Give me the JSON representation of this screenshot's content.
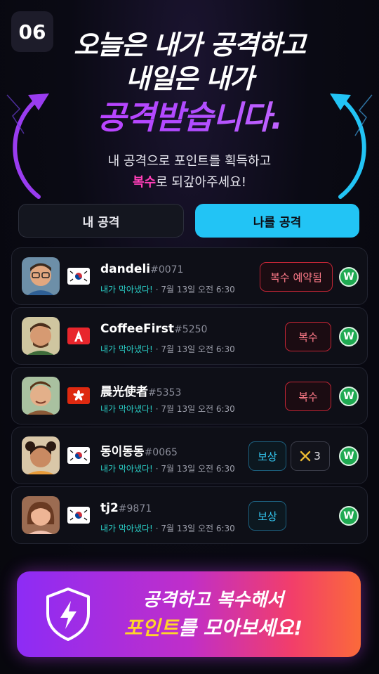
{
  "step_number": "06",
  "headline": {
    "line1": "오늘은 내가 공격하고",
    "line2": "내일은 내가",
    "line3": "공격받습니다."
  },
  "subtitle": {
    "line1": "내 공격으로 포인트를 획득하고",
    "line2_highlight": "복수",
    "line2_rest": "로 되갚아주세요!"
  },
  "tabs": [
    {
      "label": "내 공격",
      "active": false
    },
    {
      "label": "나를 공격",
      "active": true
    }
  ],
  "rows": [
    {
      "name": "dandeli",
      "tag": "#0071",
      "flag": "south-korea",
      "status": "내가 막아냈다!",
      "time": "· 7월 13일 오전 6:30",
      "revenge_label": "복수 예약됨",
      "reward_label": "",
      "count": "",
      "result": "W"
    },
    {
      "name": "CoffeeFirst",
      "tag": "#5250",
      "flag": "red-a-flag",
      "status": "내가 막아냈다!",
      "time": "· 7월 13일 오전 6:30",
      "revenge_label": "복수",
      "reward_label": "",
      "count": "",
      "result": "W"
    },
    {
      "name": "晨光使者",
      "tag": "#5353",
      "flag": "hong-kong",
      "status": "내가 막아냈다!",
      "time": "· 7월 13일 오전 6:30",
      "revenge_label": "복수",
      "reward_label": "",
      "count": "",
      "result": "W"
    },
    {
      "name": "동이동동",
      "tag": "#0065",
      "flag": "south-korea",
      "status": "내가 막아냈다!",
      "time": "· 7월 13일 오전 6:30",
      "revenge_label": "",
      "reward_label": "보상",
      "count": "3",
      "result": "W"
    },
    {
      "name": "tj2",
      "tag": "#9871",
      "flag": "south-korea",
      "status": "내가 막아냈다!",
      "time": "· 7월 13일 오전 6:30",
      "revenge_label": "",
      "reward_label": "보상",
      "count": "",
      "result": "W"
    }
  ],
  "cta": {
    "line1": "공격하고 복수해서",
    "line2_highlight": "포인트",
    "line2_rest": "를 모아보세요!"
  },
  "colors": {
    "accent_purple": "#b04bff",
    "accent_cyan": "#22c4f5",
    "revenge_red": "#c02535",
    "win_green": "#1faa52",
    "gold": "#ffd52a"
  }
}
